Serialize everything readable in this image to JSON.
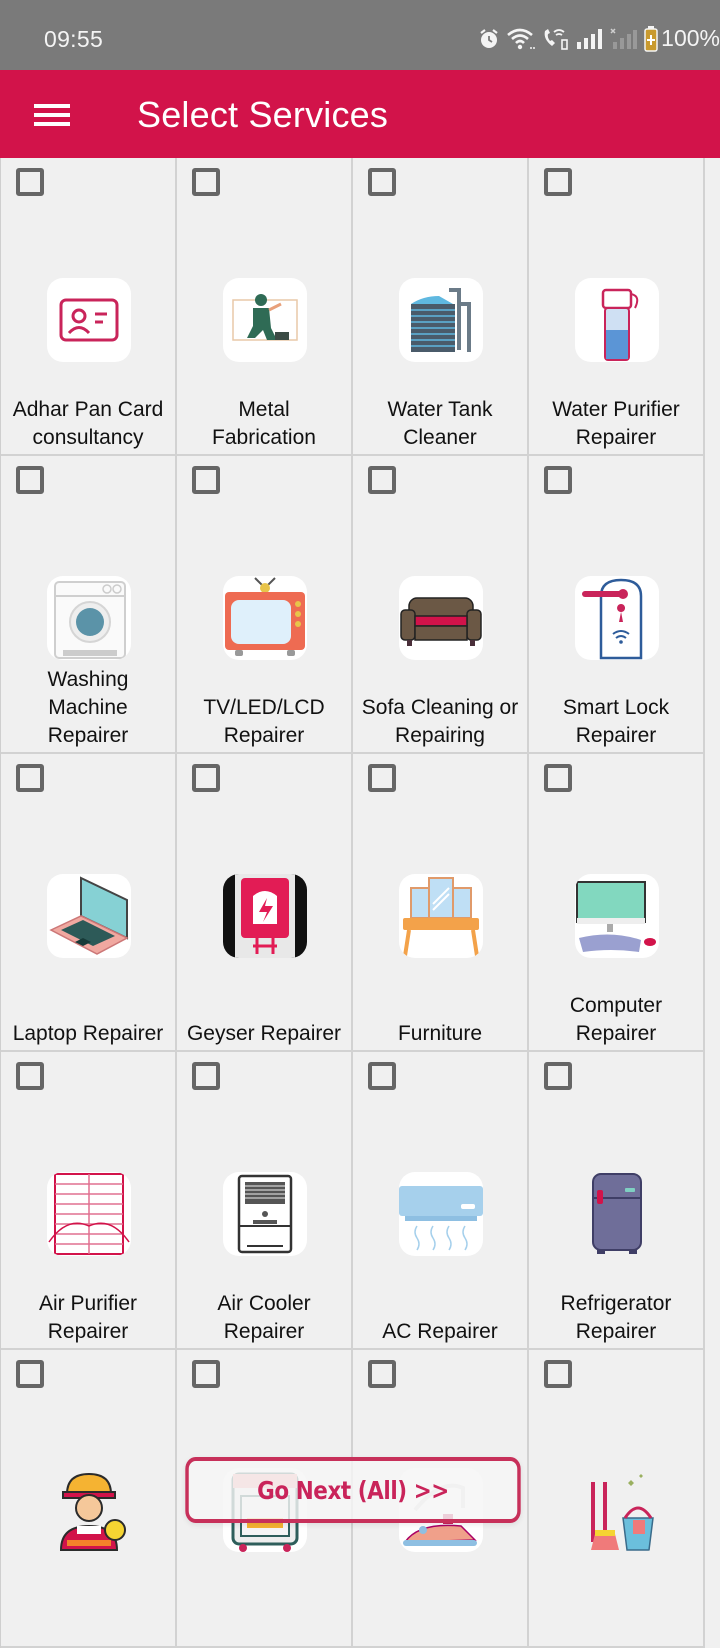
{
  "status_bar": {
    "time": "09:55",
    "icons": [
      "alarm-icon",
      "wifi-icon",
      "wifi-calling-icon",
      "signal-icon",
      "signal-no-service-icon",
      "battery-charging-icon"
    ],
    "battery": "100%"
  },
  "app_bar": {
    "menu_icon": "hamburger-menu-icon",
    "title": "Select Services"
  },
  "colors": {
    "accent": "#d2134a",
    "status_bar_bg": "#7a7a7a",
    "cell_bg": "#f0f0f0",
    "button_border": "#c7305a"
  },
  "services": [
    {
      "label_lines": [
        "Adhar Pan Card",
        "consultancy"
      ],
      "icon": "id-card-icon",
      "checked": false
    },
    {
      "label_lines": [
        "Metal",
        "Fabrication"
      ],
      "icon": "metal-worker-icon",
      "checked": false
    },
    {
      "label_lines": [
        "Water Tank",
        "Cleaner"
      ],
      "icon": "water-tank-icon",
      "checked": false
    },
    {
      "label_lines": [
        "Water Purifier",
        "Repairer"
      ],
      "icon": "water-purifier-icon",
      "checked": false
    },
    {
      "label_lines": [
        "Washing",
        "Machine",
        "Repairer"
      ],
      "icon": "washing-machine-icon",
      "checked": false
    },
    {
      "label_lines": [
        "TV/LED/LCD",
        "Repairer"
      ],
      "icon": "tv-icon",
      "checked": false
    },
    {
      "label_lines": [
        "Sofa Cleaning or",
        "Repairing"
      ],
      "icon": "sofa-icon",
      "checked": false
    },
    {
      "label_lines": [
        "Smart Lock",
        "Repairer"
      ],
      "icon": "smart-lock-icon",
      "checked": false
    },
    {
      "label_lines": [
        "Laptop Repairer"
      ],
      "icon": "laptop-icon",
      "checked": false
    },
    {
      "label_lines": [
        "Geyser Repairer"
      ],
      "icon": "geyser-icon",
      "checked": false
    },
    {
      "label_lines": [
        "Furniture"
      ],
      "icon": "dressing-table-icon",
      "checked": false
    },
    {
      "label_lines": [
        "Computer",
        "Repairer"
      ],
      "icon": "computer-icon",
      "checked": false
    },
    {
      "label_lines": [
        "Air Purifier",
        "Repairer"
      ],
      "icon": "air-purifier-icon",
      "checked": false
    },
    {
      "label_lines": [
        "Air Cooler",
        "Repairer"
      ],
      "icon": "air-cooler-icon",
      "checked": false
    },
    {
      "label_lines": [
        "AC Repairer"
      ],
      "icon": "air-conditioner-icon",
      "checked": false
    },
    {
      "label_lines": [
        "Refrigerator",
        "Repairer"
      ],
      "icon": "refrigerator-icon",
      "checked": false
    },
    {
      "label_lines": [],
      "icon": "electrician-icon",
      "checked": false
    },
    {
      "label_lines": [],
      "icon": "oven-icon",
      "checked": false
    },
    {
      "label_lines": [],
      "icon": "iron-icon",
      "checked": false
    },
    {
      "label_lines": [],
      "icon": "cleaning-supplies-icon",
      "checked": false
    }
  ],
  "go_next_button": {
    "label": "Go Next (All) >>"
  }
}
